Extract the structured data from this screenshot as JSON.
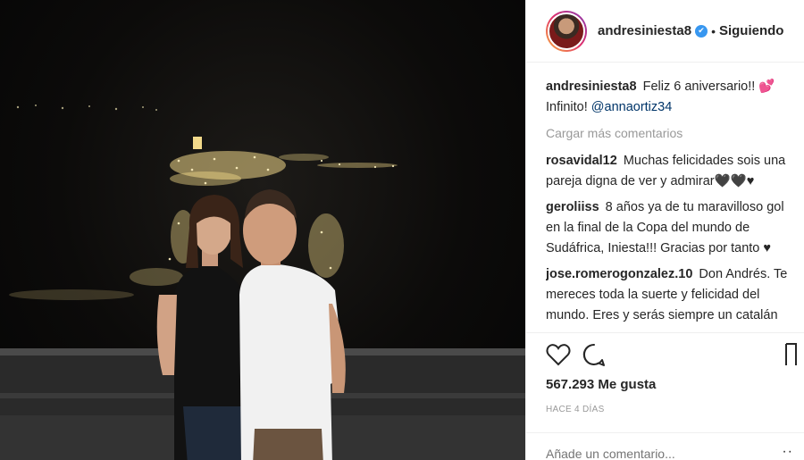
{
  "post": {
    "username": "andresiniesta8",
    "follow_state": "Siguiendo",
    "caption_text": "Feliz 6 aniversario!! 💕 Infinito!",
    "caption_mention": "@annaortiz34",
    "load_more": "Cargar más comentarios",
    "comments": [
      {
        "user": "rosavidal12",
        "text": "Muchas felicidades sois una pareja digna de ver y admirar🖤🖤♥"
      },
      {
        "user": "geroliiss",
        "text": "8 años ya de tu maravilloso gol en la final de la Copa del mundo de Sudáfrica, Iniesta!!! Gracias por tanto ♥"
      },
      {
        "user": "jose.romerogonzalez.10",
        "text": "Don Andrés. Te mereces toda la suerte y felicidad del mundo. Eres y serás siempre un catalán de"
      }
    ],
    "likes": "567.293 Me gusta",
    "time": "HACE 4 DÍAS",
    "comment_placeholder": "Añade un comentario...",
    "more_label": "··"
  },
  "icons": {
    "like": "heart-icon",
    "comment": "comment-icon",
    "save": "bookmark-icon"
  },
  "colors": {
    "verified": "#3897f0",
    "muted": "#999999",
    "text": "#262626"
  }
}
